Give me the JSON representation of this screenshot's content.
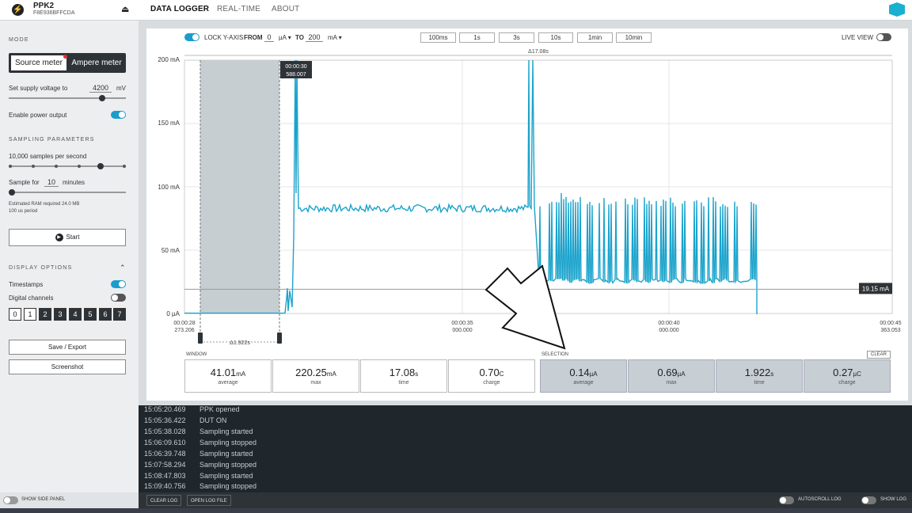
{
  "header": {
    "device_name": "PPK2",
    "device_serial": "F8E936BFFCDA",
    "tabs": [
      "DATA LOGGER",
      "REAL-TIME",
      "ABOUT"
    ],
    "active_tab": "DATA LOGGER"
  },
  "sidebar": {
    "mode_heading": "MODE",
    "mode_source": "Source meter",
    "mode_ampere": "Ampere meter",
    "supply_label": "Set supply voltage to",
    "supply_value": "4200",
    "supply_unit": "mV",
    "supply_level": 0.8,
    "enable_power_label": "Enable power output",
    "enable_power_on": true,
    "sampling_heading": "SAMPLING PARAMETERS",
    "samples_label": "10,000 samples per second",
    "sample_for_label": "Sample for",
    "sample_for_value": "10",
    "sample_for_unit": "minutes",
    "ram_note": "Estimated RAM required 24.0 MB",
    "period_note": "100 us period",
    "start_label": "Start",
    "display_heading": "DISPLAY OPTIONS",
    "timestamps_label": "Timestamps",
    "digital_label": "Digital channels",
    "digital_channels": [
      "0",
      "1",
      "2",
      "3",
      "4",
      "5",
      "6",
      "7"
    ],
    "save_label": "Save / Export",
    "screenshot_label": "Screenshot"
  },
  "chart_controls": {
    "lock_label": "LOCK Y-AXIS",
    "from_label": "FROM",
    "from_value": "0",
    "from_unit": "µA",
    "to_label": "TO",
    "to_value": "200",
    "to_unit": "mA",
    "windows": [
      "100ms",
      "1s",
      "3s",
      "10s",
      "1min",
      "10min"
    ],
    "live_label": "LIVE VIEW"
  },
  "chart_data": {
    "type": "line",
    "ylim": [
      0,
      200
    ],
    "yunit": "mA",
    "y_ticks": [
      "200 mA",
      "150 mA",
      "100 mA",
      "50 mA",
      "0 µA"
    ],
    "x_ticks": [
      {
        "time": "00:00:28",
        "sub": "273.206"
      },
      {
        "time": "00:00:35",
        "sub": "000.000"
      },
      {
        "time": "00:00:40",
        "sub": "000.000"
      },
      {
        "time": "00:00:45",
        "sub": "363.053"
      }
    ],
    "delta_top": "Δ17.08s",
    "delta_bottom": "Δ1.922s",
    "cursor_time": "00:00:30",
    "cursor_value": "588.007",
    "marker_value": "19.15 mA",
    "series": [
      {
        "color": "#1ba3cc"
      }
    ]
  },
  "stats": {
    "window_label": "WINDOW",
    "selection_label": "SELECTION",
    "clear_label": "CLEAR",
    "window": [
      {
        "value": "41.01",
        "unit": "mA",
        "name": "average"
      },
      {
        "value": "220.25",
        "unit": "mA",
        "name": "max"
      },
      {
        "value": "17.08",
        "unit": "s",
        "name": "time"
      },
      {
        "value": "0.70",
        "unit": "C",
        "name": "charge"
      }
    ],
    "selection": [
      {
        "value": "0.14",
        "unit": "µA",
        "name": "average"
      },
      {
        "value": "0.69",
        "unit": "µA",
        "name": "max"
      },
      {
        "value": "1.922",
        "unit": "s",
        "name": "time"
      },
      {
        "value": "0.27",
        "unit": "µC",
        "name": "charge"
      }
    ]
  },
  "log": [
    {
      "time": "15:05:20.469",
      "msg": "PPK opened"
    },
    {
      "time": "15:05:36.422",
      "msg": "DUT ON"
    },
    {
      "time": "15:05:38.028",
      "msg": "Sampling started"
    },
    {
      "time": "15:06:09.610",
      "msg": "Sampling stopped"
    },
    {
      "time": "15:06:39.748",
      "msg": "Sampling started"
    },
    {
      "time": "15:07:58.294",
      "msg": "Sampling stopped"
    },
    {
      "time": "15:08:47.803",
      "msg": "Sampling started"
    },
    {
      "time": "15:09:40.756",
      "msg": "Sampling stopped"
    }
  ],
  "footer": {
    "show_side_panel": "SHOW SIDE PANEL",
    "clear_log": "CLEAR LOG",
    "open_log_file": "OPEN LOG FILE",
    "autoscroll_log": "AUTOSCROLL LOG",
    "show_log": "SHOW LOG"
  }
}
